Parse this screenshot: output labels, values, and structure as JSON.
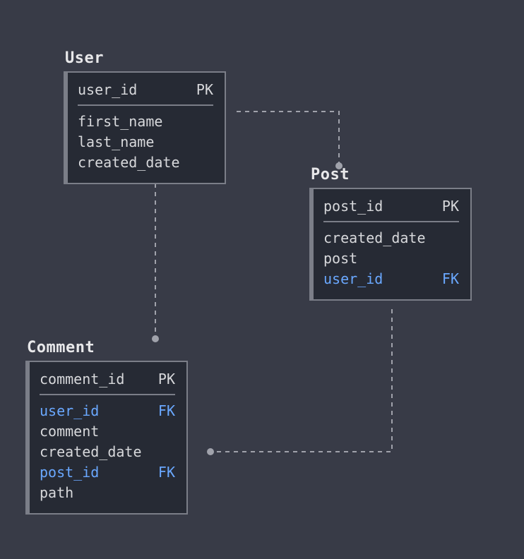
{
  "labels": {
    "pk": "PK",
    "fk": "FK"
  },
  "entities": {
    "user": {
      "title": "User",
      "pk": "user_id",
      "fields": [
        {
          "name": "first_name",
          "fk": false
        },
        {
          "name": "last_name",
          "fk": false
        },
        {
          "name": "created_date",
          "fk": false
        }
      ]
    },
    "post": {
      "title": "Post",
      "pk": "post_id",
      "fields": [
        {
          "name": "created_date",
          "fk": false
        },
        {
          "name": "post",
          "fk": false
        },
        {
          "name": "user_id",
          "fk": true
        }
      ]
    },
    "comment": {
      "title": "Comment",
      "pk": "comment_id",
      "fields": [
        {
          "name": "user_id",
          "fk": true
        },
        {
          "name": "comment",
          "fk": false
        },
        {
          "name": "created_date",
          "fk": false
        },
        {
          "name": "post_id",
          "fk": true
        },
        {
          "name": "path",
          "fk": false
        }
      ]
    }
  },
  "relations": [
    {
      "from": "user",
      "to": "post"
    },
    {
      "from": "user",
      "to": "comment"
    },
    {
      "from": "post",
      "to": "comment"
    }
  ]
}
